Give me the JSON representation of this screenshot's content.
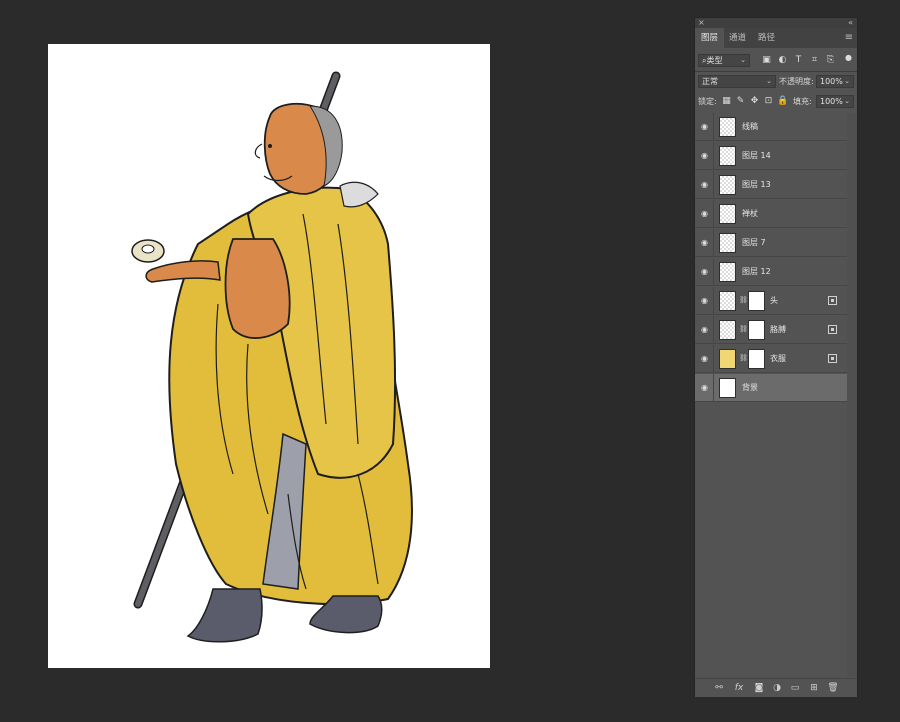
{
  "panel": {
    "close_glyph": "×",
    "collapse_glyph": "«",
    "menu_glyph": "≡",
    "tabs": [
      {
        "label": "图层",
        "active": true
      },
      {
        "label": "通道",
        "active": false
      },
      {
        "label": "路径",
        "active": false
      }
    ],
    "filter": {
      "value": "类型",
      "icon": "search-icon"
    },
    "filter_icons": [
      "image-filter-icon",
      "adjustment-filter-icon",
      "type-filter-icon",
      "shape-filter-icon",
      "smart-object-filter-icon",
      "filter-toggle-icon"
    ],
    "blend_mode": "正常",
    "opacity_label": "不透明度:",
    "opacity_value": "100%",
    "lock_label": "锁定:",
    "lock_icons": [
      "lock-transparent-icon",
      "lock-image-icon",
      "lock-position-icon",
      "lock-artboard-icon",
      "lock-all-icon"
    ],
    "fill_label": "填充:",
    "fill_value": "100%"
  },
  "layers": [
    {
      "name": "线稿",
      "mask": false,
      "smart": false,
      "selected": false,
      "visible": true
    },
    {
      "name": "图层 14",
      "mask": false,
      "smart": false,
      "selected": false,
      "visible": true
    },
    {
      "name": "图层 13",
      "mask": false,
      "smart": false,
      "selected": false,
      "visible": true
    },
    {
      "name": "禅杖",
      "mask": false,
      "smart": false,
      "selected": false,
      "visible": true
    },
    {
      "name": "图层 7",
      "mask": false,
      "smart": false,
      "selected": false,
      "visible": true
    },
    {
      "name": "图层 12",
      "mask": false,
      "smart": false,
      "selected": false,
      "visible": true
    },
    {
      "name": "头",
      "mask": true,
      "smart": true,
      "selected": false,
      "visible": true
    },
    {
      "name": "胳膊",
      "mask": true,
      "smart": true,
      "selected": false,
      "visible": true
    },
    {
      "name": "衣服",
      "mask": true,
      "smart": true,
      "selected": false,
      "visible": true
    },
    {
      "name": "背景",
      "mask": false,
      "smart": false,
      "selected": true,
      "visible": true
    }
  ],
  "bottom_icons": [
    "link-layers-icon",
    "layer-style-icon",
    "add-mask-icon",
    "adjustment-layer-icon",
    "new-group-icon",
    "new-layer-icon",
    "delete-layer-icon"
  ],
  "colors": {
    "robe": "#e2bd3c",
    "skin": "#d98a4a",
    "pants": "#9da0aa",
    "staff": "#5f5f63",
    "boots": "#5a5c6c",
    "panel_bg": "#535353",
    "selected_row": "#6b6b6b"
  }
}
